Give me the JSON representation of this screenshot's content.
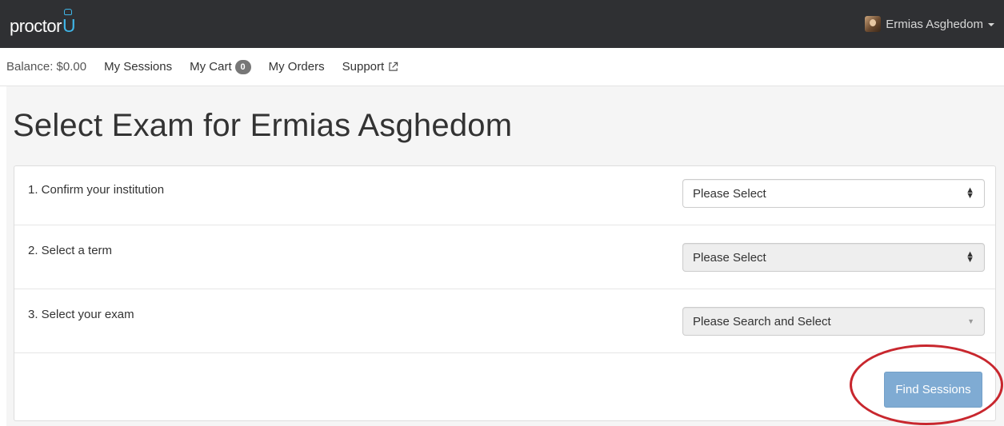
{
  "topbar": {
    "logo_text": "proctor",
    "logo_accent": "U",
    "user_name": "Ermias Asghedom",
    "brand_color": "#3fb6e9",
    "bar_color": "#2f3033"
  },
  "subnav": {
    "balance": "Balance: $0.00",
    "my_sessions": "My Sessions",
    "my_cart": "My Cart",
    "cart_count": "0",
    "my_orders": "My Orders",
    "support": "Support"
  },
  "page": {
    "title": "Select Exam for Ermias Asghedom"
  },
  "form": {
    "steps": [
      {
        "label": "1. Confirm your institution",
        "value": "Please Select",
        "disabled": false
      },
      {
        "label": "2. Select a term",
        "value": "Please Select",
        "disabled": true
      },
      {
        "label": "3. Select your exam",
        "value": "Please Search and Select",
        "disabled": true
      }
    ],
    "submit_label": "Find Sessions",
    "submit_color": "#7fabd3"
  },
  "annotation": {
    "ring_color": "#c8272e"
  }
}
